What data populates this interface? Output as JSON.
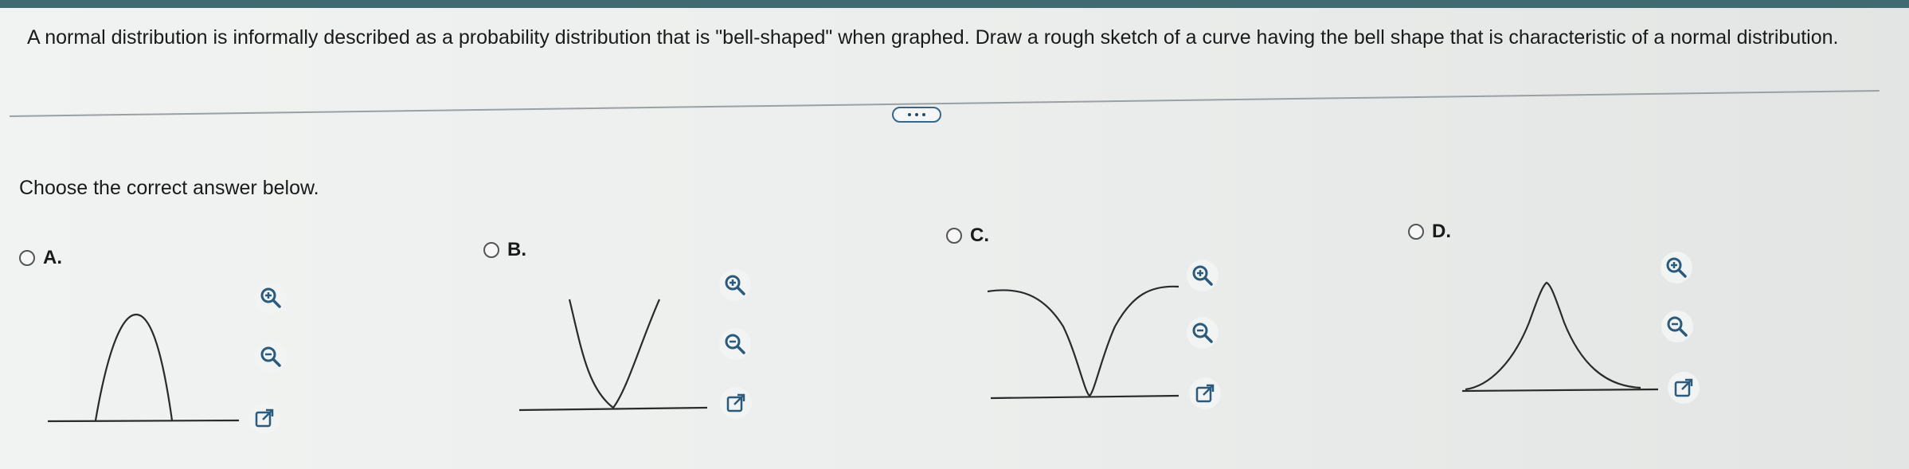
{
  "question": {
    "text": "A normal distribution is informally described as a probability distribution that is \"bell-shaped\" when graphed. Draw a rough sketch of a curve having the bell shape that is characteristic of a normal distribution."
  },
  "prompt": "Choose the correct answer below.",
  "options": [
    {
      "label": "A.",
      "icons": [
        "zoom-in-icon",
        "zoom-out-icon",
        "pop-out-icon"
      ]
    },
    {
      "label": "B.",
      "icons": [
        "zoom-in-icon",
        "zoom-out-icon",
        "pop-out-icon"
      ]
    },
    {
      "label": "C.",
      "icons": [
        "zoom-in-icon",
        "zoom-out-icon",
        "pop-out-icon"
      ]
    },
    {
      "label": "D.",
      "icons": [
        "zoom-in-icon",
        "zoom-out-icon",
        "pop-out-icon"
      ]
    }
  ],
  "colors": {
    "accent": "#3f6a72",
    "link": "#2a5a7c",
    "curve": "#2a2a2a"
  }
}
